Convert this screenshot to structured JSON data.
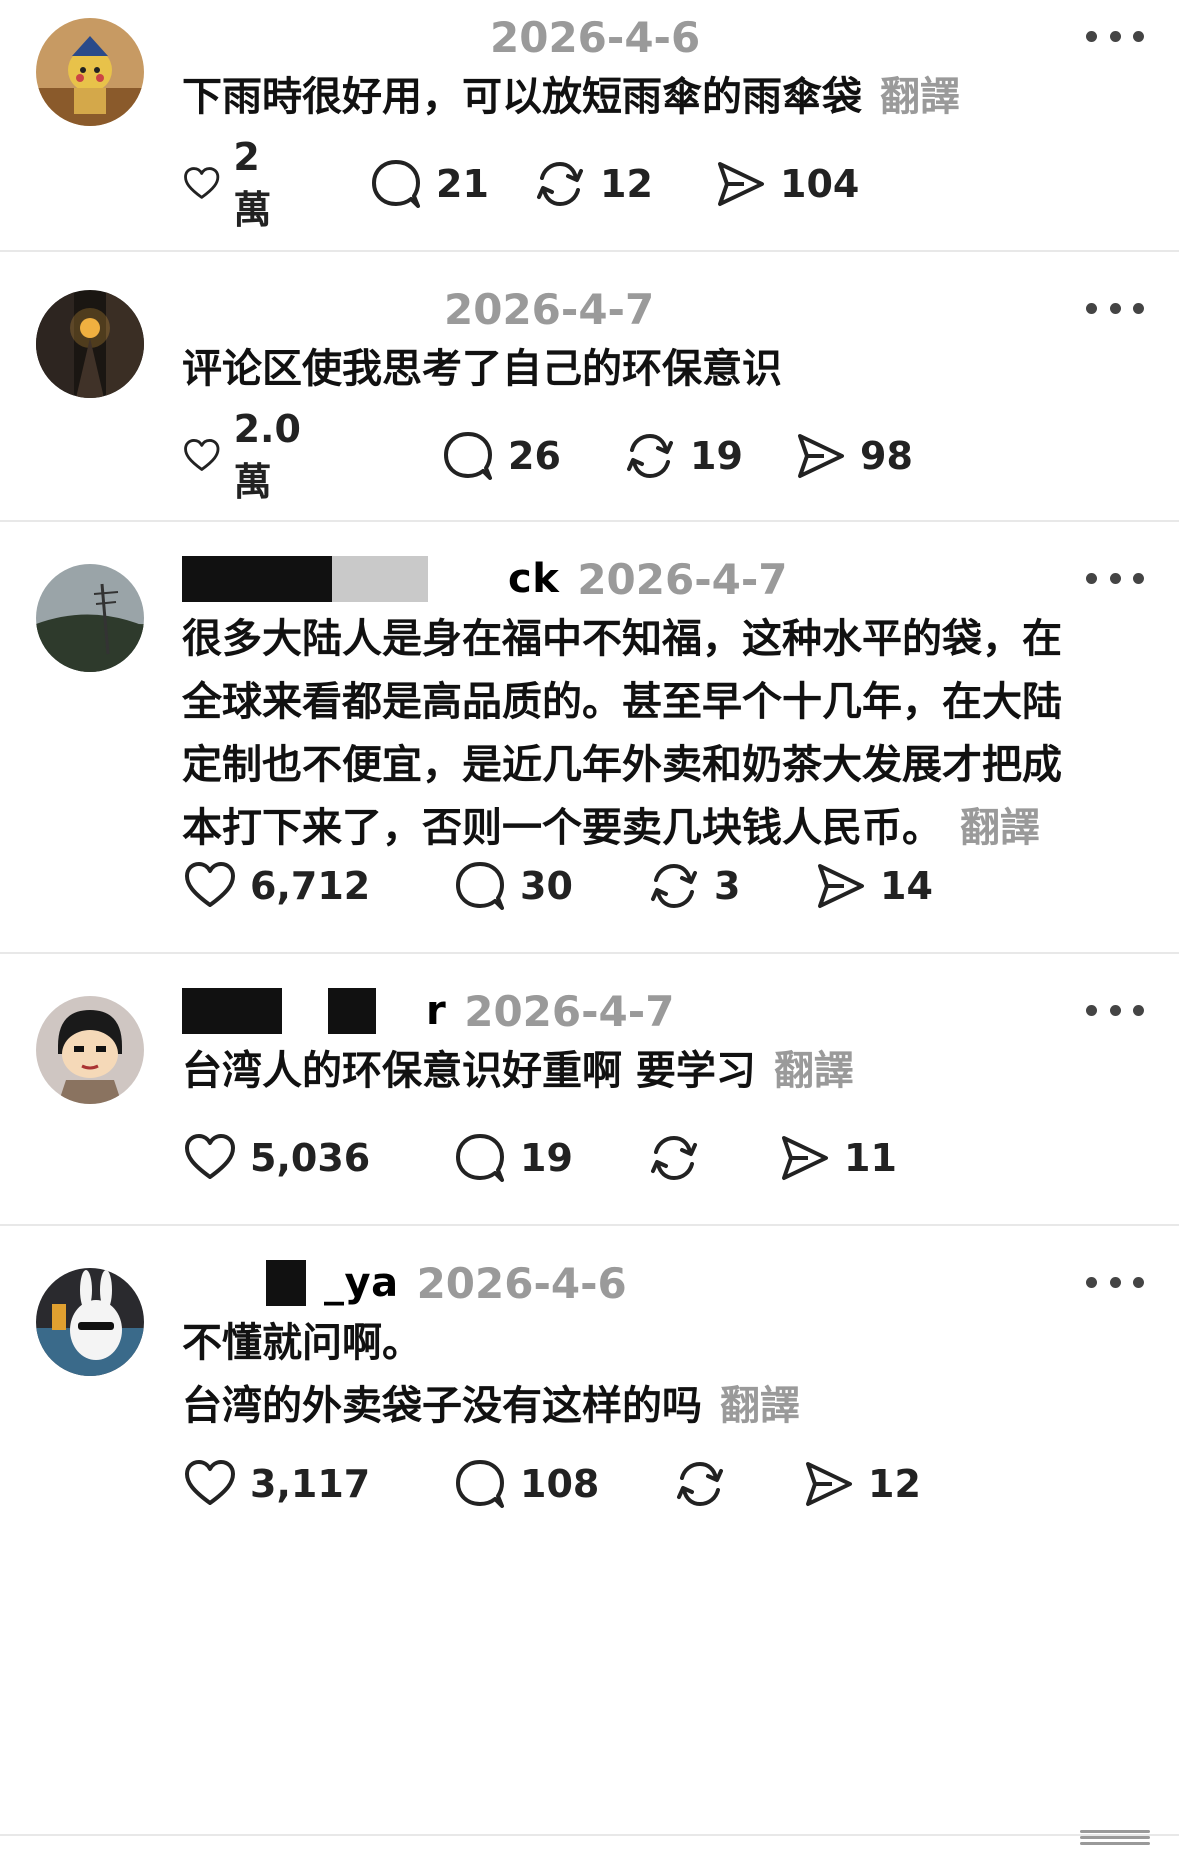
{
  "comments": [
    {
      "username": "",
      "date": "2026-4-6",
      "lines": [
        "下雨時很好用，可以放短雨傘的雨傘袋"
      ],
      "translate": "翻譯",
      "likes": "2 萬",
      "replies": "21",
      "reposts": "12",
      "shares": "104"
    },
    {
      "username": "",
      "date": "2026-4-7",
      "lines": [
        "评论区使我思考了自己的环保意识"
      ],
      "translate": "",
      "likes": "2.0 萬",
      "replies": "26",
      "reposts": "19",
      "shares": "98"
    },
    {
      "username": "ck",
      "date": "2026-4-7",
      "lines": [
        "很多大陆人是身在福中不知福，这种水平的袋，在",
        "全球来看都是高品质的。甚至早个十几年，在大陆",
        "定制也不便宜，是近几年外卖和奶茶大发展才把成",
        "本打下来了，否则一个要卖几块钱人民币。"
      ],
      "translate": "翻譯",
      "likes": "6,712",
      "replies": "30",
      "reposts": "3",
      "shares": "14"
    },
    {
      "username": "r",
      "date": "2026-4-7",
      "lines": [
        "台湾人的环保意识好重啊 要学习"
      ],
      "translate": "翻譯",
      "likes": "5,036",
      "replies": "19",
      "reposts": "",
      "shares": "11"
    },
    {
      "username": "_ya",
      "date": "2026-4-6",
      "lines": [
        "不懂就问啊。",
        "台湾的外卖袋子没有这样的吗"
      ],
      "translate": "翻譯",
      "likes": "3,117",
      "replies": "108",
      "reposts": "",
      "shares": "12"
    }
  ],
  "icons": {
    "like": "heart-icon",
    "reply": "speech-bubble-icon",
    "repost": "repost-arrows-icon",
    "share": "send-icon",
    "more": "more-dots-icon"
  },
  "colors": {
    "date": "#9a9a9a",
    "translate": "#9a9a9a",
    "divider": "#e8e8e8"
  }
}
